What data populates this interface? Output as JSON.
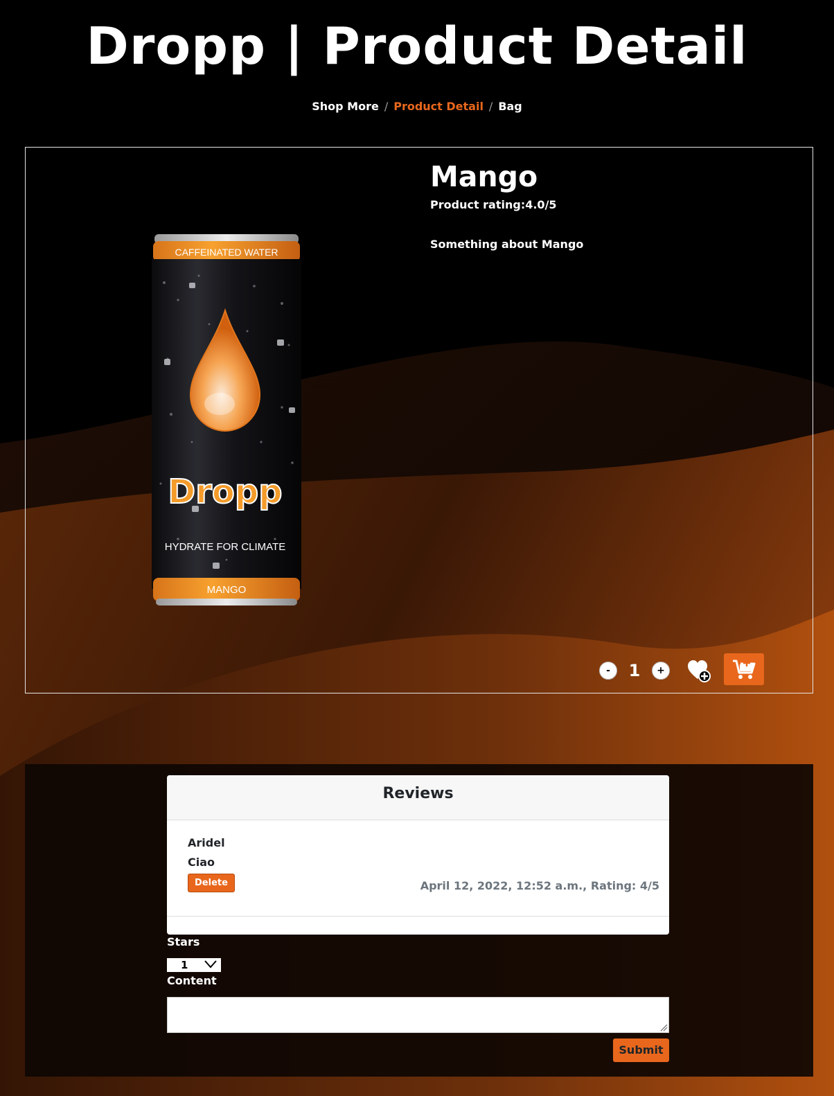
{
  "page": {
    "title": "Dropp | Product Detail"
  },
  "breadcrumb": {
    "items": [
      "Shop More",
      "Product Detail",
      "Bag"
    ],
    "active_index": 1
  },
  "product": {
    "name": "Mango",
    "rating_label": "Product rating:",
    "rating_value": "4.0/5",
    "description": "Something about Mango",
    "can": {
      "top_text": "CAFFEINATED WATER",
      "brand": "Dropp",
      "tagline": "HYDRATE FOR CLIMATE",
      "flavor": "MANGO"
    }
  },
  "quantity": {
    "minus": "-",
    "value": "1",
    "plus": "+"
  },
  "icons": {
    "minus": "minus-icon",
    "plus": "plus-icon",
    "wishlist": "heart-plus-icon",
    "cart": "cart-plus-icon",
    "select_arrow": "chevron-down-icon",
    "resize": "resize-handle-icon"
  },
  "reviews": {
    "header": "Reviews",
    "items": [
      {
        "author": "Aridel",
        "content": "Ciao",
        "delete_label": "Delete",
        "meta": "April 12, 2022, 12:52 a.m., Rating: 4/5"
      }
    ]
  },
  "form": {
    "stars_label": "Stars",
    "stars_value": "1",
    "content_label": "Content",
    "content_value": "",
    "submit_label": "Submit"
  },
  "colors": {
    "accent": "#e8671c",
    "background": "#000000",
    "wave_dark": "#1a0c05",
    "wave_orange": "#a4480f"
  }
}
